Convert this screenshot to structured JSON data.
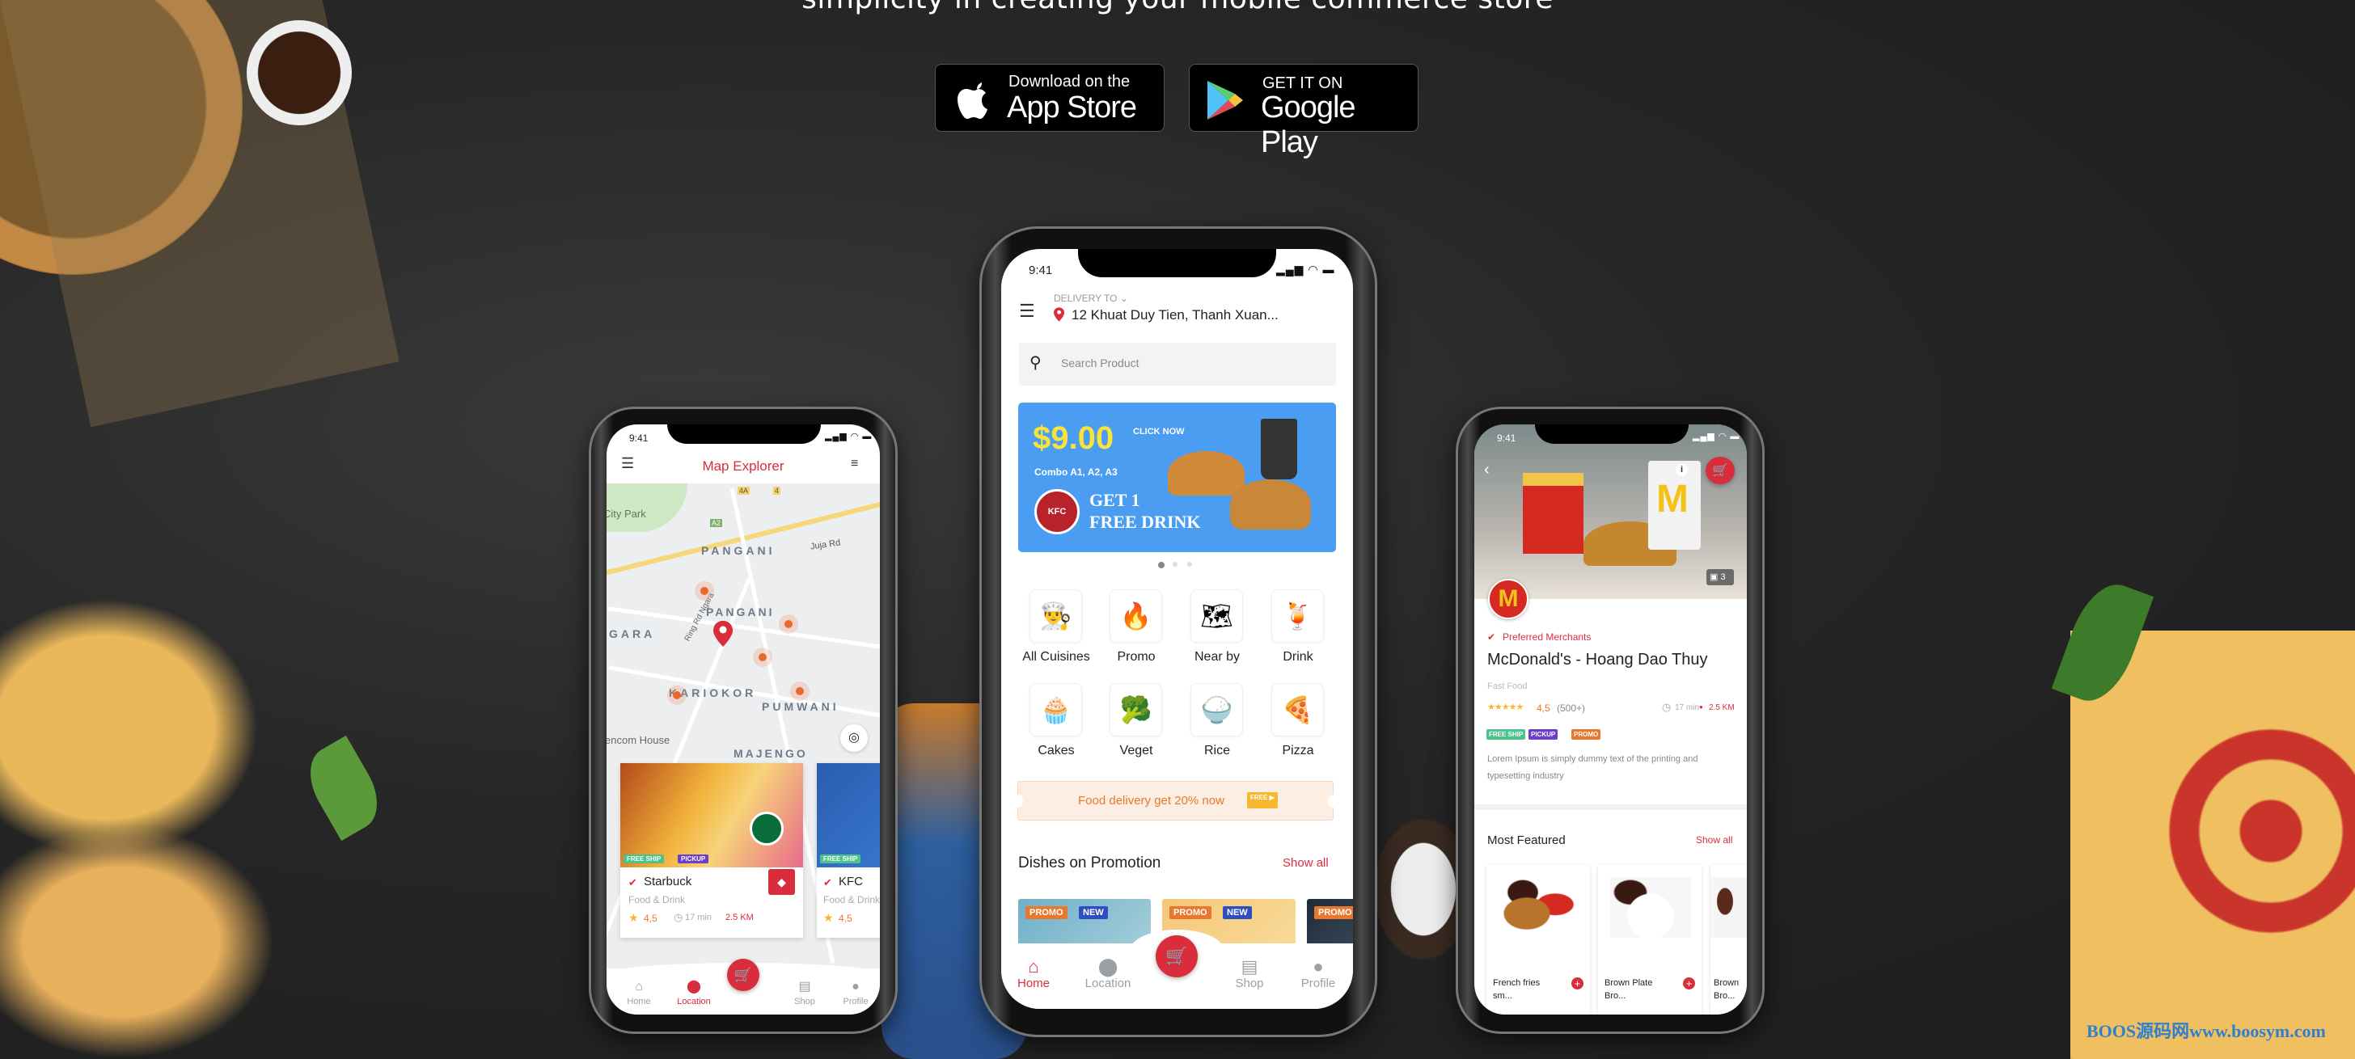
{
  "hero": {
    "headline": "simplicity in creating your mobile commerce store",
    "app_store": {
      "small": "Download on the",
      "big": "App Store"
    },
    "google_play": {
      "small": "GET IT ON",
      "big": "Google Play"
    }
  },
  "colors": {
    "brand_red": "#d92d3c",
    "promo_orange": "#e8782e",
    "new_blue": "#2f4fc1",
    "free_ship_green": "#4cc38a",
    "pickup_purple": "#6b3fc9",
    "banner_blue": "#4a9df0"
  },
  "status_bar": {
    "time": "9:41"
  },
  "home_phone": {
    "delivery_label": "DELIVERY TO",
    "address": "12 Khuat Duy Tien, Thanh Xuan...",
    "search_placeholder": "Search Product",
    "banner": {
      "price": "$9.00",
      "cta": "CLICK NOW",
      "combo": "Combo A1, A2, A3",
      "line1": "GET 1",
      "line2": "FREE DRINK",
      "logo": "KFC"
    },
    "carousel": {
      "active_index": 0,
      "count": 3
    },
    "categories": [
      {
        "label": "All Cuisines",
        "icon": "chef-icon",
        "glyph": "👨‍🍳"
      },
      {
        "label": "Promo",
        "icon": "hot-deal-icon",
        "glyph": "🔥"
      },
      {
        "label": "Near by",
        "icon": "map-icon",
        "glyph": "🗺"
      },
      {
        "label": "Drink",
        "icon": "drink-icon",
        "glyph": "🍹"
      },
      {
        "label": "Cakes",
        "icon": "cupcake-icon",
        "glyph": "🧁"
      },
      {
        "label": "Veget",
        "icon": "vegetable-icon",
        "glyph": "🥦"
      },
      {
        "label": "Rice",
        "icon": "rice-bowl-icon",
        "glyph": "🍚"
      },
      {
        "label": "Pizza",
        "icon": "pizza-icon",
        "glyph": "🍕"
      }
    ],
    "coupon": {
      "text": "Food delivery get 20% now",
      "truck_label": "FREE"
    },
    "section_title": "Dishes on Promotion",
    "show_all": "Show all",
    "promo_badges": {
      "promo": "PROMO",
      "new": "NEW"
    },
    "nav": [
      {
        "label": "Home",
        "icon": "home-icon",
        "active": true
      },
      {
        "label": "Location",
        "icon": "location-icon",
        "active": false
      },
      {
        "label": "Shop",
        "icon": "shop-icon",
        "active": false
      },
      {
        "label": "Profile",
        "icon": "profile-icon",
        "active": false
      }
    ]
  },
  "map_phone": {
    "title": "Map Explorer",
    "map_labels": {
      "city_park": "City Park",
      "pangani1": "PANGANI",
      "pangani2": "PANGANI",
      "gara": "GARA",
      "kariokor": "KARIOKOR",
      "pumwani": "PUMWANI",
      "majengo": "MAJENGO",
      "house": "encom House",
      "juja": "Juja Rd",
      "ring": "Ring Rd Ngara",
      "road_4a": "4A",
      "road_4": "4",
      "road_a2": "A2"
    },
    "cards": [
      {
        "name": "Starbuck",
        "category": "Food & Drink",
        "rating": "4,5",
        "time": "17 min",
        "distance": "2.5 KM",
        "badges": [
          "FREE SHIP",
          "PICKUP"
        ]
      },
      {
        "name": "KFC",
        "category": "Food & Drink",
        "rating": "4,5",
        "badges": [
          "FREE SHIP"
        ]
      }
    ],
    "nav": [
      {
        "label": "Home",
        "icon": "home-icon",
        "active": false
      },
      {
        "label": "Location",
        "icon": "location-icon",
        "active": true
      },
      {
        "label": "Shop",
        "icon": "shop-icon",
        "active": false
      },
      {
        "label": "Profile",
        "icon": "profile-icon",
        "active": false
      }
    ]
  },
  "store_phone": {
    "photo_count": "3",
    "preferred": "Preferred Merchants",
    "name": "McDonald's - Hoang Dao Thuy",
    "category": "Fast Food",
    "rating": "4,5",
    "rating_stars": 5,
    "reviews": "(500+)",
    "time": "17 min",
    "distance": "2.5 KM",
    "badges": [
      "FREE SHIP",
      "PICKUP",
      "PROMO"
    ],
    "description": "Lorem Ipsum is simply dummy text of the printing and typesetting industry",
    "featured_title": "Most Featured",
    "show_all": "Show all",
    "products": [
      {
        "name": "French fries sm..."
      },
      {
        "name": "Brown Plate Bro..."
      },
      {
        "name": "Brown Bro..."
      }
    ]
  },
  "watermark": "BOOS源码网www.boosym.com"
}
